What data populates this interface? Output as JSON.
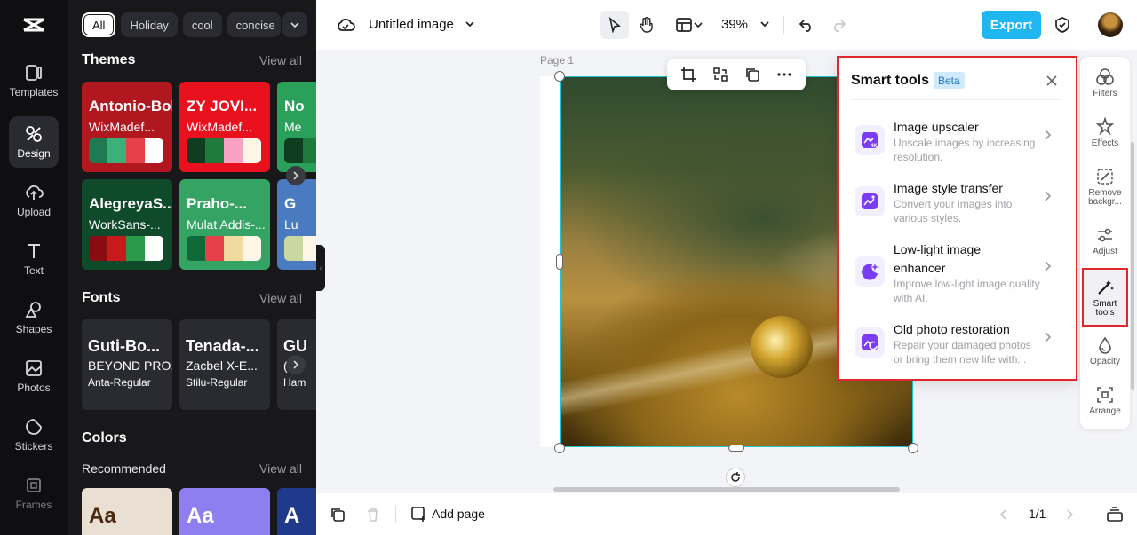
{
  "app": {
    "doc_title": "Untitled image",
    "zoom": "39%",
    "export_label": "Export",
    "page_label": "Page 1",
    "page_counter": "1/1",
    "add_page_label": "Add page"
  },
  "nav": [
    {
      "label": "Templates",
      "icon": "templates-icon"
    },
    {
      "label": "Design",
      "icon": "design-icon",
      "active": true
    },
    {
      "label": "Upload",
      "icon": "upload-icon"
    },
    {
      "label": "Text",
      "icon": "text-icon"
    },
    {
      "label": "Shapes",
      "icon": "shapes-icon"
    },
    {
      "label": "Photos",
      "icon": "photos-icon"
    },
    {
      "label": "Stickers",
      "icon": "stickers-icon"
    },
    {
      "label": "Frames",
      "icon": "frames-icon"
    }
  ],
  "filters": [
    "All",
    "Holiday",
    "cool",
    "concise"
  ],
  "sections": {
    "themes": "Themes",
    "fonts": "Fonts",
    "colors": "Colors",
    "recommended": "Recommended",
    "view_all": "View all"
  },
  "themes": [
    {
      "title": "Antonio-Bold",
      "sub": "WixMadef...",
      "bg": "#b1171f",
      "swatches": [
        "#1e7a52",
        "#3cb07a",
        "#e8404a",
        "#ffffff"
      ]
    },
    {
      "title": "ZY JOVI...",
      "sub": "WixMadef...",
      "bg": "#e8111d",
      "swatches": [
        "#0f3d1f",
        "#1f7a3c",
        "#f6a2c0",
        "#fdf6e6"
      ]
    },
    {
      "title": "No",
      "sub": "Me",
      "bg": "#2aa05a",
      "swatches": [
        "#0f3d1f",
        "#1f7a3c",
        "#f6a2c0",
        "#fdf6e6"
      ]
    },
    {
      "title": "AlegreyaS...",
      "sub": "WorkSans-...",
      "bg": "#0f4a2a",
      "swatches": [
        "#8a0b10",
        "#c81a1a",
        "#2a9a4a",
        "#ffffff"
      ]
    },
    {
      "title": "Praho-...",
      "sub": "Mulat Addis-...",
      "bg": "#34a364",
      "swatches": [
        "#0f6a3a",
        "#e8404a",
        "#f2d9a0",
        "#fdf6e6"
      ]
    },
    {
      "title": "G",
      "sub": "Lu",
      "bg": "#4a7ac0",
      "swatches": [
        "#c8d8a0",
        "#fdf6e6",
        "#fdf6e6",
        "#fdf6e6"
      ]
    }
  ],
  "fonts": [
    {
      "f1": "Guti-Bo...",
      "f2": "BEYOND PRO...",
      "f3": "Anta-Regular"
    },
    {
      "f1": "Tenada-...",
      "f2": "Zacbel X-E...",
      "f3": "Stilu-Regular"
    },
    {
      "f1": "GU",
      "f2": "(",
      "f3": "Ham"
    }
  ],
  "colors": [
    {
      "text": "Aa",
      "bg": "#e9dfd2",
      "fg": "#4a2a10"
    },
    {
      "text": "Aa",
      "bg": "#8f7ef0",
      "fg": "#ffffff"
    },
    {
      "text": "A",
      "bg": "#1f3a8a",
      "fg": "#ffffff"
    }
  ],
  "smart_tools": {
    "title": "Smart tools",
    "badge": "Beta",
    "tools": [
      {
        "name": "Image upscaler",
        "desc": "Upscale images by increasing resolution.",
        "icon": "image-upscaler-icon"
      },
      {
        "name": "Image style transfer",
        "desc": "Convert your images into various styles.",
        "icon": "style-transfer-icon"
      },
      {
        "name": "Low-light image enhancer",
        "desc": "Improve low-light image quality with AI.",
        "icon": "low-light-icon"
      },
      {
        "name": "Old photo restoration",
        "desc": "Repair your damaged photos or bring them new life with...",
        "icon": "photo-restoration-icon"
      }
    ]
  },
  "right_rail": [
    {
      "label": "Filters",
      "icon": "filters-icon"
    },
    {
      "label": "Effects",
      "icon": "effects-icon"
    },
    {
      "label": "Remove backgr...",
      "icon": "remove-background-icon"
    },
    {
      "label": "Adjust",
      "icon": "adjust-icon"
    },
    {
      "label": "Smart tools",
      "icon": "smart-tools-icon",
      "active": true
    },
    {
      "label": "Opacity",
      "icon": "opacity-icon"
    },
    {
      "label": "Arrange",
      "icon": "arrange-icon"
    }
  ],
  "colors_accent": {
    "export": "#1fb6f2",
    "highlight": "#e0262e",
    "selection": "#20c6d6"
  }
}
